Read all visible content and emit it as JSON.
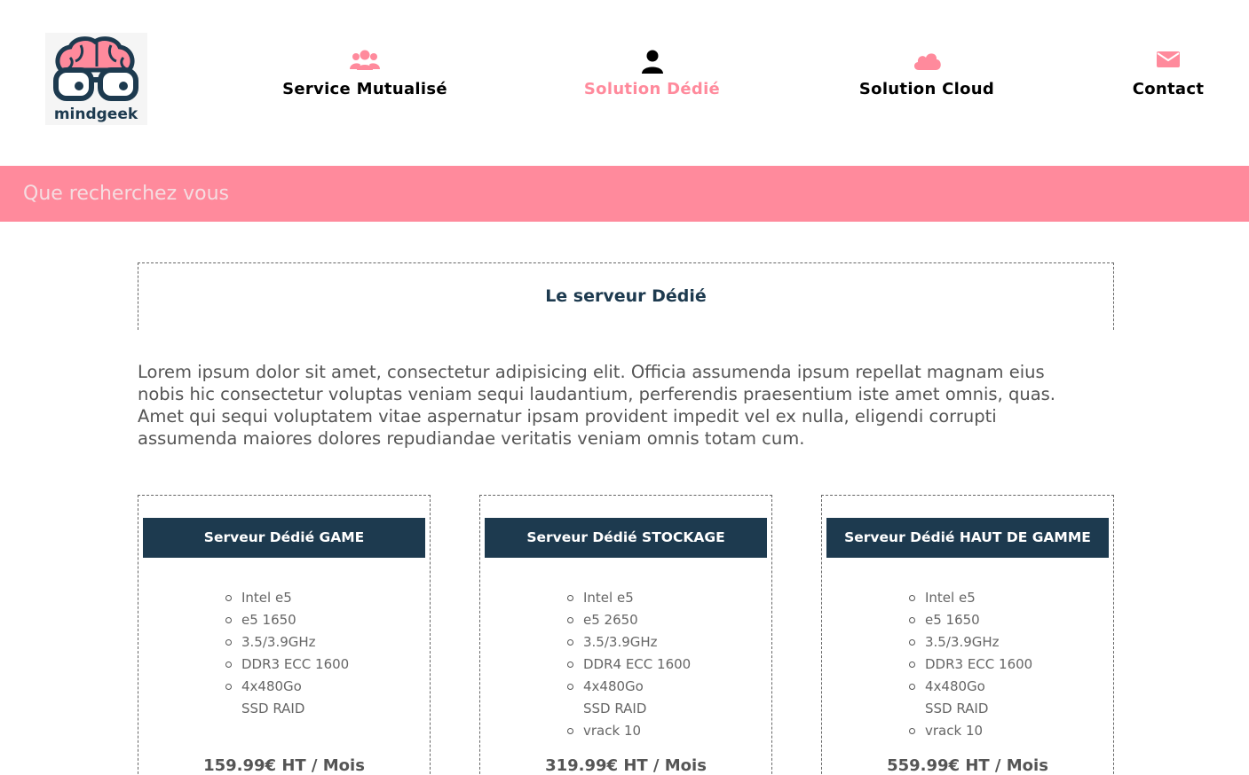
{
  "logo": {
    "text": "mindgeek",
    "icon": "nerd-brain-glasses-logo"
  },
  "colors": {
    "accent": "#ff8a9c",
    "navy": "#1d3a4f"
  },
  "nav": [
    {
      "label": "Service Mutualisé",
      "icon": "users-icon",
      "active": false
    },
    {
      "label": "Solution Dédié",
      "icon": "user-icon",
      "active": true
    },
    {
      "label": "Solution Cloud",
      "icon": "cloud-icon",
      "active": false
    },
    {
      "label": "Contact",
      "icon": "envelope-icon",
      "active": false
    }
  ],
  "search": {
    "placeholder": "Que recherchez vous",
    "value": ""
  },
  "main": {
    "title": "Le serveur Dédié",
    "intro": "Lorem ipsum dolor sit amet, consectetur adipisicing elit. Officia assumenda ipsum repellat magnam eius nobis hic consectetur voluptas veniam sequi laudantium, perferendis praesentium iste amet omnis, quas. Amet qui sequi voluptatem vitae aspernatur ipsam provident impedit vel ex nulla, eligendi corrupti assumenda maiores dolores repudiandae veritatis veniam omnis totam cum."
  },
  "cards": [
    {
      "title": "Serveur Dédié GAME",
      "specs": [
        "Intel e5",
        "e5 1650",
        "3.5/3.9GHz",
        "DDR3 ECC 1600",
        "4x480Go SSD RAID"
      ],
      "price": "159.99€ HT / Mois"
    },
    {
      "title": "Serveur Dédié STOCKAGE",
      "specs": [
        "Intel e5",
        "e5 2650",
        "3.5/3.9GHz",
        "DDR4 ECC 1600",
        "4x480Go SSD RAID",
        "vrack 10"
      ],
      "price": "319.99€ HT / Mois"
    },
    {
      "title": "Serveur Dédié HAUT DE GAMME",
      "specs": [
        "Intel e5",
        "e5 1650",
        "3.5/3.9GHz",
        "DDR3 ECC 1600",
        "4x480Go SSD RAID",
        "vrack 10"
      ],
      "price": "559.99€ HT / Mois"
    }
  ]
}
